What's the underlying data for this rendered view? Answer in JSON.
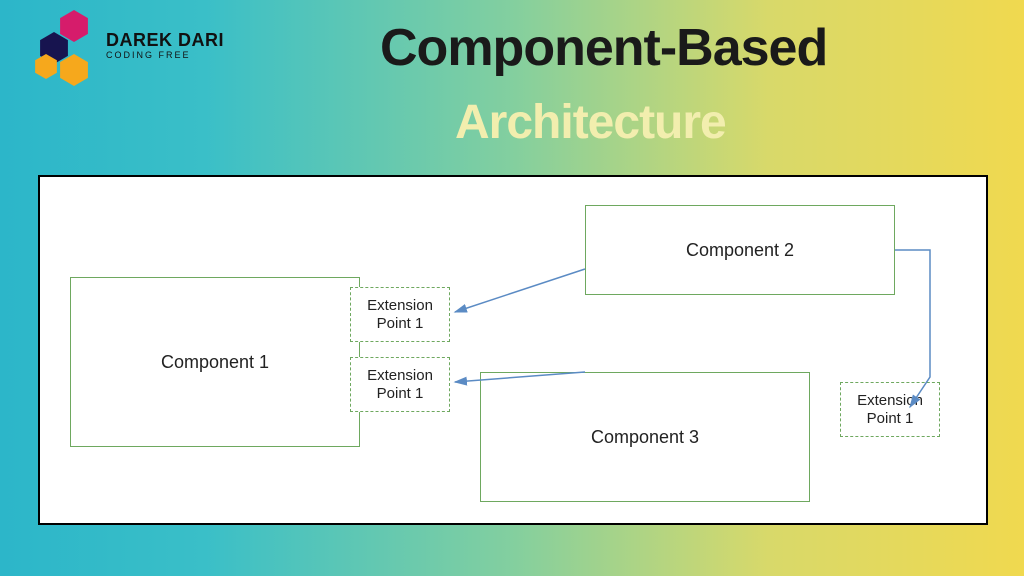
{
  "logo": {
    "title": "DAREK DARI",
    "subtitle": "CODING FREE",
    "hex_colors": [
      "#d61c6b",
      "#17144f",
      "#f6a81c",
      "#f6a81c"
    ]
  },
  "headline": "Component-Based",
  "subheadline": "Architecture",
  "diagram": {
    "components": [
      {
        "id": "c1",
        "label": "Component 1"
      },
      {
        "id": "c2",
        "label": "Component 2"
      },
      {
        "id": "c3",
        "label": "Component 3"
      }
    ],
    "extension_points": [
      {
        "id": "e1",
        "label": "Extension\nPoint 1"
      },
      {
        "id": "e2",
        "label": "Extension\nPoint 1"
      },
      {
        "id": "e3",
        "label": "Extension\nPoint 1"
      }
    ],
    "arrows": [
      {
        "from": "c2",
        "to": "e1"
      },
      {
        "from": "c3",
        "to": "e2"
      },
      {
        "from": "c2",
        "to": "e3"
      }
    ],
    "arrow_color": "#5b8bc4"
  }
}
